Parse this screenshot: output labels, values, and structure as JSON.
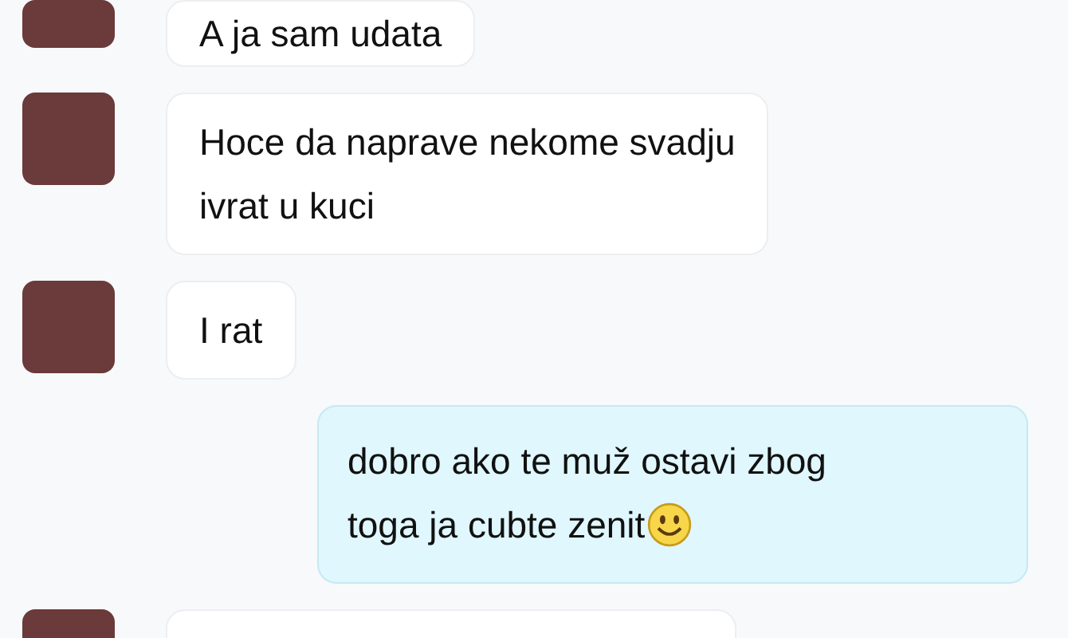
{
  "messages": [
    {
      "kind": "incoming",
      "lines": [
        "A ja sam udata"
      ]
    },
    {
      "kind": "incoming",
      "lines": [
        "Hoce da naprave nekome svadju",
        "ivrat u kuci"
      ]
    },
    {
      "kind": "incoming",
      "lines": [
        "I rat"
      ]
    },
    {
      "kind": "outgoing",
      "lines": [
        "dobro ako te muž ostavi zbog",
        "toga ja cubte zenit"
      ],
      "emoji_at_end": true
    },
    {
      "kind": "incoming"
    }
  ]
}
